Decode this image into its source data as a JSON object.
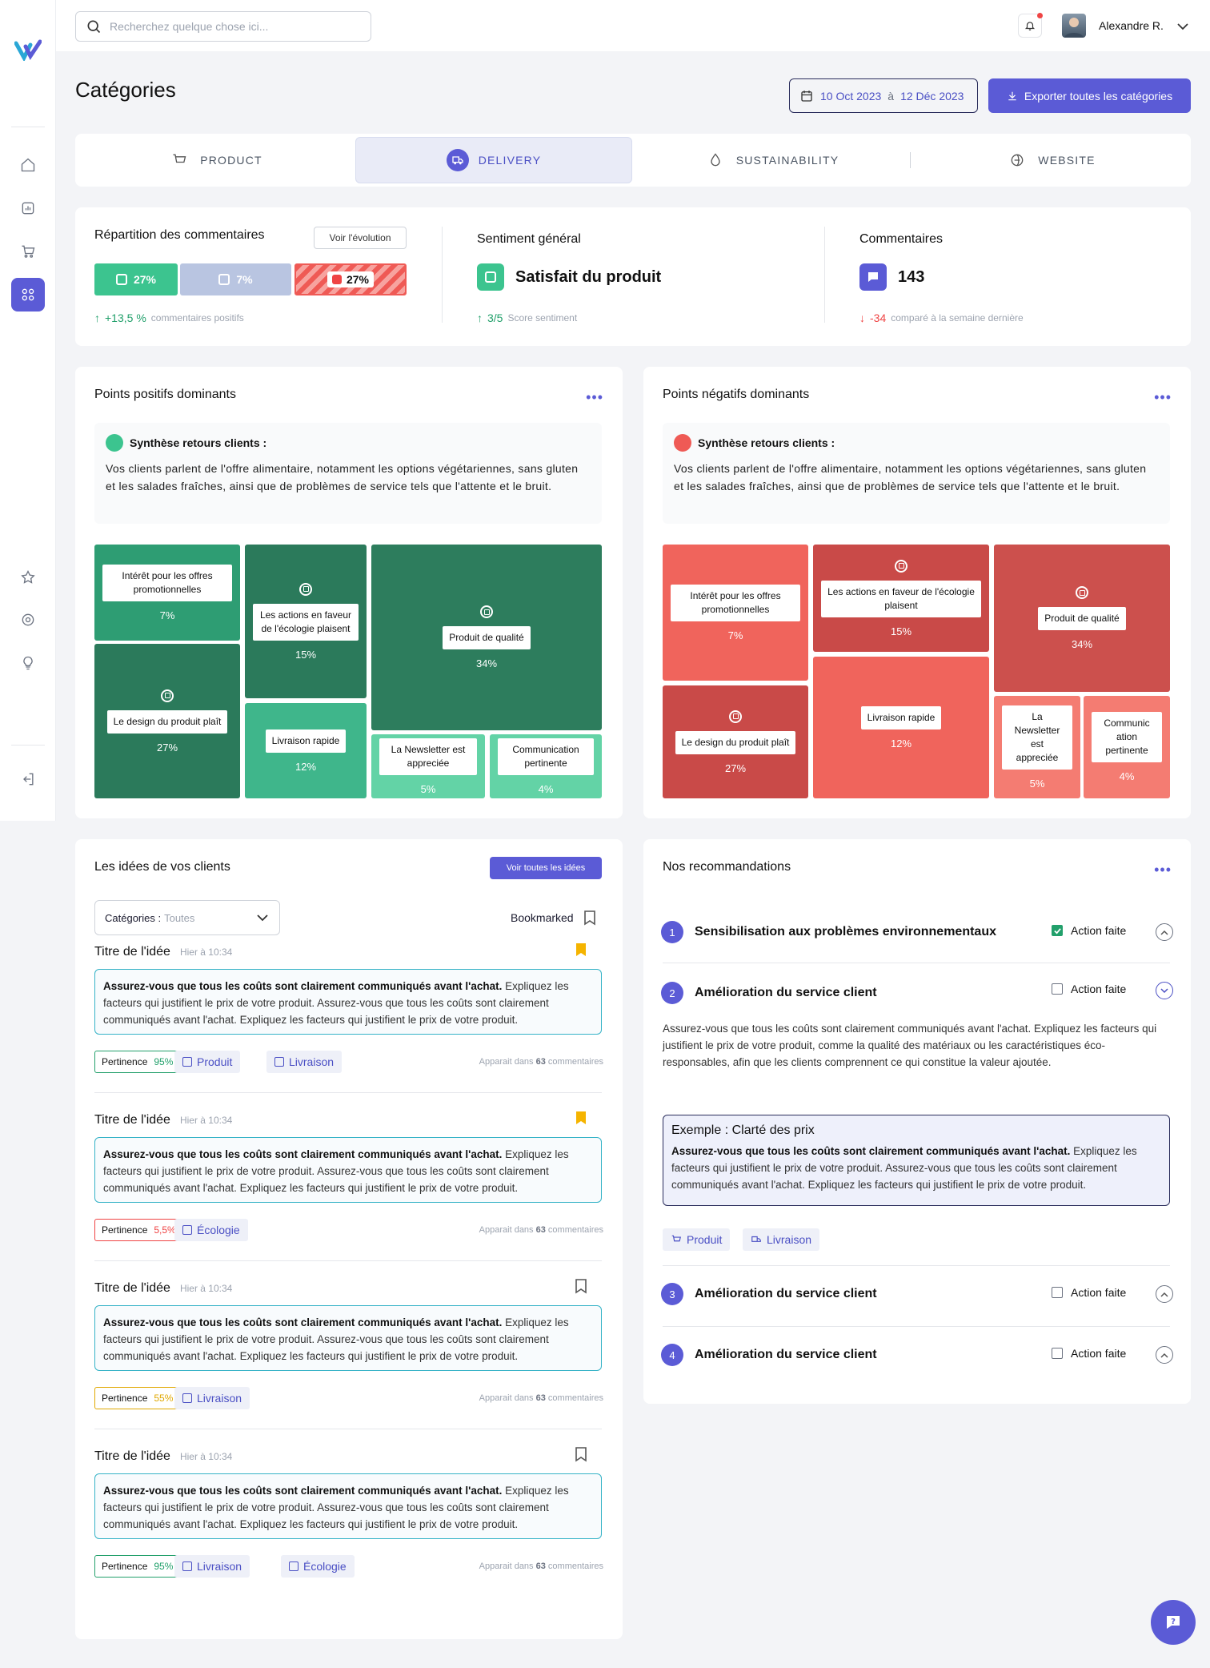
{
  "topbar": {
    "search_placeholder": "Recherchez quelque chose ici...",
    "username": "Alexandre R."
  },
  "page": {
    "title": "Catégories",
    "date_from": "10 Oct 2023",
    "date_sep": "à",
    "date_to": "12 Déc 2023",
    "export_label": "Exporter toutes les catégories"
  },
  "tabs": [
    {
      "label": "PRODUCT"
    },
    {
      "label": "DELIVERY"
    },
    {
      "label": "SUSTAINABILITY"
    },
    {
      "label": "WEBSITE"
    }
  ],
  "stats": {
    "repartition": {
      "title": "Répartition des commentaires",
      "btn": "Voir l'évolution",
      "positive": "27%",
      "neutral": "7%",
      "negative": "27%",
      "delta": "+13,5 %",
      "delta_label": "commentaires positifs"
    },
    "sentiment": {
      "title": "Sentiment général",
      "value": "Satisfait du produit",
      "score": "3/5",
      "score_label": "Score sentiment"
    },
    "comments": {
      "title": "Commentaires",
      "value": "143",
      "delta": "-34",
      "delta_label": "comparé à la semaine dernière"
    }
  },
  "positive": {
    "title": "Points positifs dominants",
    "summary_title": "Synthèse retours clients :",
    "summary_body": "Vos clients parlent de l'offre alimentaire, notamment les options végétariennes, sans gluten et les salades fraîches, ainsi que de problèmes de service tels que l'attente et le bruit.",
    "tiles": [
      {
        "label": "Intérêt pour les offres promotionnelles",
        "pct": "7%",
        "color": "#2e9d73"
      },
      {
        "label": "Le design du produit plaît",
        "pct": "27%",
        "color": "#2b7a5b"
      },
      {
        "label": "Les actions en faveur de l'écologie plaisent",
        "pct": "15%",
        "color": "#2b7a5b"
      },
      {
        "label": "Livraison rapide",
        "pct": "12%",
        "color": "#3fb68b"
      },
      {
        "label": "Produit de qualité",
        "pct": "34%",
        "color": "#2d7d5d"
      },
      {
        "label": "La Newsletter est appreciée",
        "pct": "5%",
        "color": "#63d3a6"
      },
      {
        "label": "Communication pertinente",
        "pct": "4%",
        "color": "#63d3a6"
      }
    ]
  },
  "negative": {
    "title": "Points négatifs dominants",
    "summary_title": "Synthèse retours clients :",
    "summary_body": "Vos clients parlent de l'offre alimentaire, notamment les options végétariennes, sans gluten et les salades fraîches, ainsi que de problèmes de service tels que l'attente et le bruit.",
    "tiles": [
      {
        "label": "Intérêt pour les offres promotionnelles",
        "pct": "7%",
        "color": "#f0645c"
      },
      {
        "label": "Le design du produit plaît",
        "pct": "27%",
        "color": "#c94a48"
      },
      {
        "label": "Les actions en faveur de l'écologie plaisent",
        "pct": "15%",
        "color": "#c94a48"
      },
      {
        "label": "Livraison rapide",
        "pct": "12%",
        "color": "#f0645c"
      },
      {
        "label": "Produit de qualité",
        "pct": "34%",
        "color": "#cc504d"
      },
      {
        "label": "La Newsletter est appreciée",
        "pct": "5%",
        "color": "#f47c72"
      },
      {
        "label": "Communic ation pertinente",
        "pct": "4%",
        "color": "#f47c72"
      }
    ]
  },
  "ideas": {
    "title": "Les idées de vos clients",
    "see_all": "Voir toutes les idées",
    "filter_label": "Catégories :",
    "filter_value": "Toutes",
    "bookmarked": "Bookmarked",
    "items": [
      {
        "title": "Titre de l'idée",
        "time": "Hier à 10:34",
        "bold": "Assurez-vous que tous les coûts sont clairement communiqués avant l'achat.",
        "body": " Expliquez les facteurs qui justifient le prix de votre produit. Assurez-vous que tous les coûts sont clairement communiqués avant l'achat. Expliquez les facteurs qui justifient le prix de votre produit.",
        "pert_label": "Pertinence",
        "pert_value": "95%",
        "pert_color": "#22a06b",
        "tags": [
          "Produit",
          "Livraison"
        ],
        "appears_pre": "Apparait dans ",
        "appears_num": "63",
        "appears_post": " commentaires",
        "bookmarked": true
      },
      {
        "title": "Titre de l'idée",
        "time": "Hier à 10:34",
        "bold": "Assurez-vous que tous les coûts sont clairement communiqués avant l'achat.",
        "body": " Expliquez les facteurs qui justifient le prix de votre produit. Assurez-vous que tous les coûts sont clairement communiqués avant l'achat. Expliquez les facteurs qui justifient le prix de votre produit.",
        "pert_label": "Pertinence",
        "pert_value": "5,5%",
        "pert_color": "#ef4444",
        "tags": [
          "Écologie"
        ],
        "appears_pre": "Apparait dans ",
        "appears_num": "63",
        "appears_post": " commentaires",
        "bookmarked": true
      },
      {
        "title": "Titre de l'idée",
        "time": "Hier à 10:34",
        "bold": "Assurez-vous que tous les coûts sont clairement communiqués avant l'achat.",
        "body": " Expliquez les facteurs qui justifient le prix de votre produit. Assurez-vous que tous les coûts sont clairement communiqués avant l'achat. Expliquez les facteurs qui justifient le prix de votre produit.",
        "pert_label": "Pertinence",
        "pert_value": "55%",
        "pert_color": "#e0a800",
        "tags": [
          "Livraison"
        ],
        "appears_pre": "Apparait dans ",
        "appears_num": "63",
        "appears_post": " commentaires",
        "bookmarked": false
      },
      {
        "title": "Titre de l'idée",
        "time": "Hier à 10:34",
        "bold": "Assurez-vous que tous les coûts sont clairement communiqués avant l'achat.",
        "body": " Expliquez les facteurs qui justifient le prix de votre produit. Assurez-vous que tous les coûts sont clairement communiqués avant l'achat. Expliquez les facteurs qui justifient le prix de votre produit.",
        "pert_label": "Pertinence",
        "pert_value": "95%",
        "pert_color": "#22a06b",
        "tags": [
          "Livraison",
          "Écologie"
        ],
        "appears_pre": "Apparait dans ",
        "appears_num": "63",
        "appears_post": " commentaires",
        "bookmarked": false
      }
    ]
  },
  "recs": {
    "title": "Nos recommandations",
    "items": [
      {
        "num": "1",
        "title": "Sensibilisation aux problèmes environnementaux",
        "action": "Action faite",
        "done": true
      },
      {
        "num": "2",
        "title": "Amélioration du service client",
        "action": "Action faite",
        "done": false
      },
      {
        "num": "3",
        "title": "Amélioration du service client",
        "action": "Action faite",
        "done": false
      },
      {
        "num": "4",
        "title": "Amélioration du service client",
        "action": "Action faite",
        "done": false
      }
    ],
    "expanded_text": "Assurez-vous que tous les coûts sont clairement communiqués avant l'achat. Expliquez les facteurs qui justifient le prix de votre produit, comme la qualité des matériaux ou les caractéristiques éco-responsables, afin que les clients comprennent ce qui constitue la valeur ajoutée.",
    "example_title": "Exemple : Clarté des prix",
    "example_bold": "Assurez-vous que tous les coûts sont clairement communiqués avant l'achat.",
    "example_body": " Expliquez les facteurs qui justifient le prix de votre produit. Assurez-vous que tous les coûts sont clairement communiqués avant l'achat. Expliquez les facteurs qui justifient le prix de votre produit.",
    "tags": [
      "Produit",
      "Livraison"
    ]
  }
}
